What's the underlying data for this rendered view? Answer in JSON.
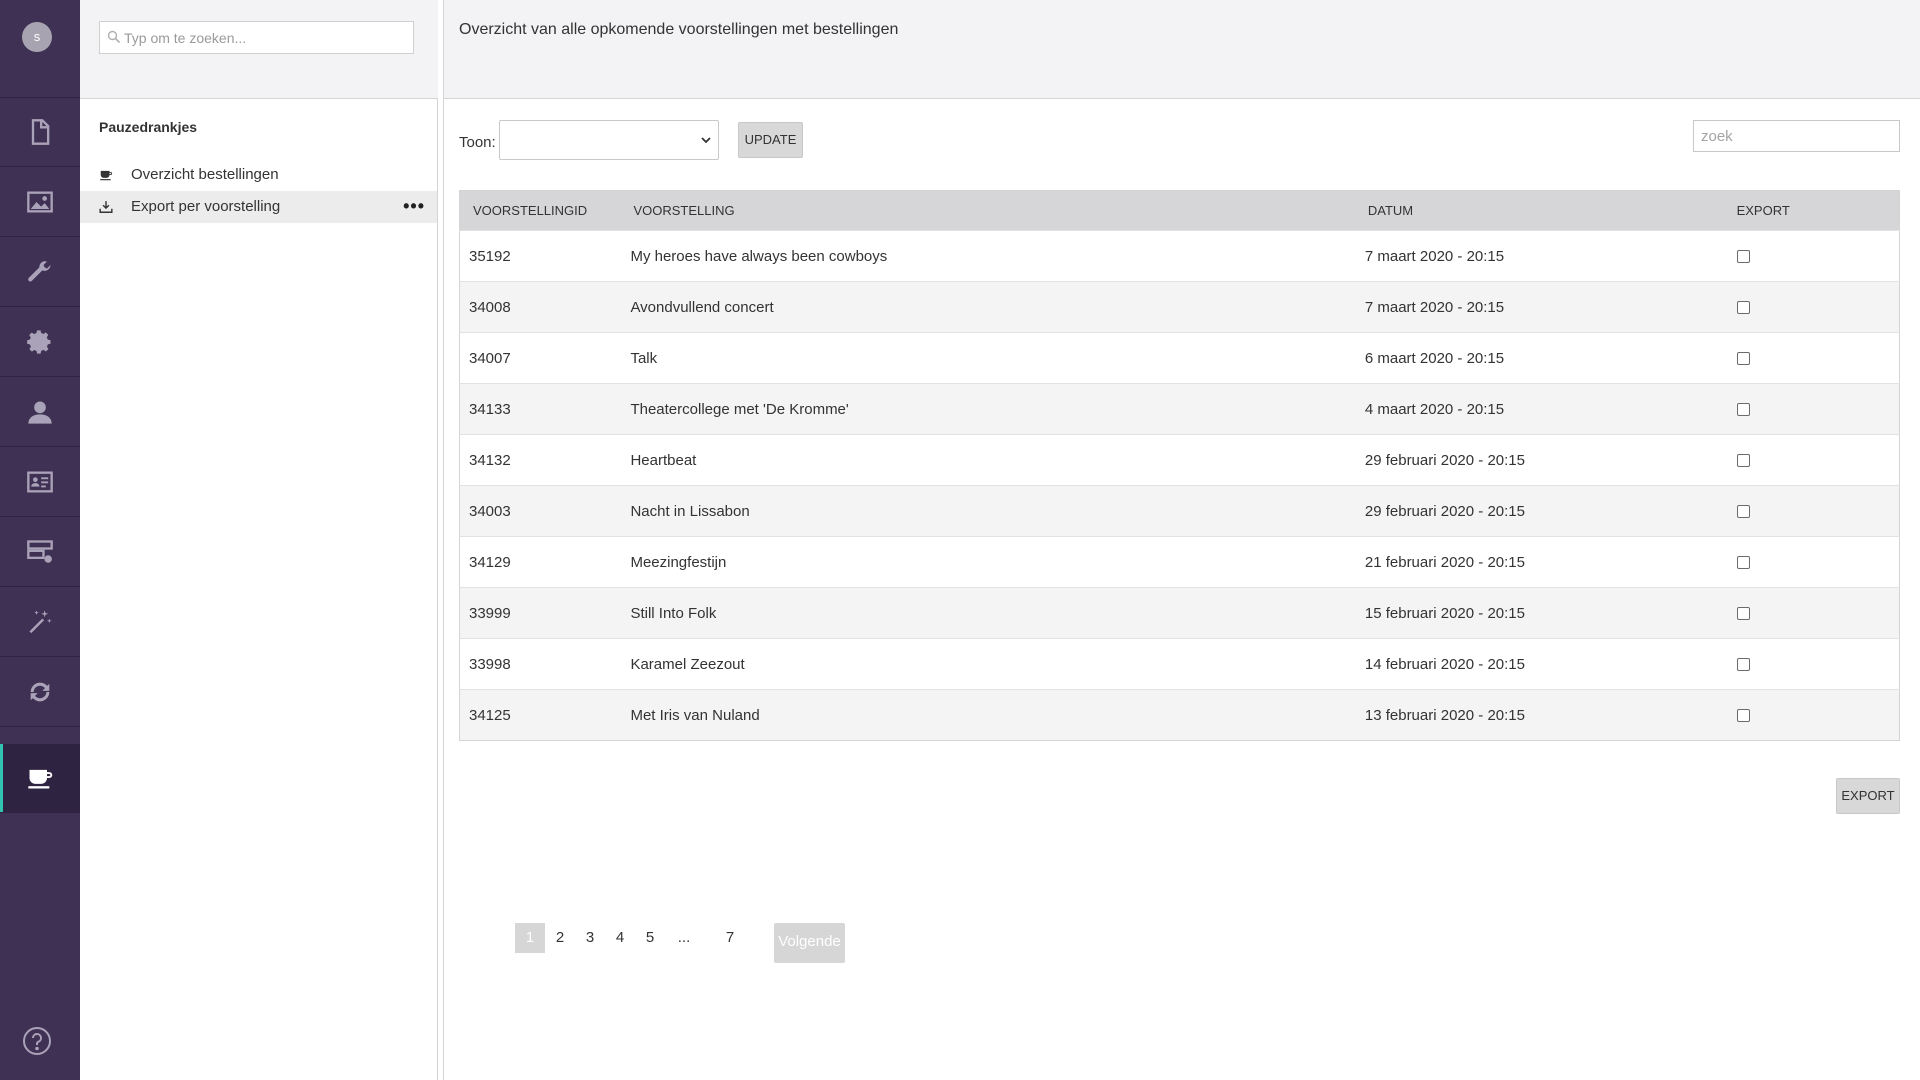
{
  "rail": {
    "avatar_letter": "s",
    "items": [
      {
        "icon": "document-icon"
      },
      {
        "icon": "image-icon"
      },
      {
        "icon": "wrench-icon"
      },
      {
        "icon": "gear-icon"
      },
      {
        "icon": "user-icon"
      },
      {
        "icon": "id-card-icon"
      },
      {
        "icon": "server-settings-icon"
      },
      {
        "icon": "magic-wand-icon"
      },
      {
        "icon": "sync-icon"
      },
      {
        "icon": "coffee-cup-icon",
        "active": true
      }
    ],
    "help_icon": "help-icon",
    "accent_color": "#33c3b0",
    "background_color": "#3e3153"
  },
  "tree": {
    "search_placeholder": "Typ om te zoeken...",
    "section_title": "Pauzedrankjes",
    "items": [
      {
        "label": "Overzicht bestellingen",
        "icon": "coffee-cup-icon"
      },
      {
        "label": "Export per voorstelling",
        "icon": "download-icon",
        "selected": true,
        "more": "•••"
      }
    ]
  },
  "main": {
    "title": "Overzicht van alle opkomende voorstellingen met bestellingen",
    "toon_label": "Toon:",
    "toon_value": "",
    "update_label": "UPDATE",
    "search_placeholder": "zoek",
    "export_label": "EXPORT",
    "table": {
      "headers": [
        "VOORSTELLINGID",
        "VOORSTELLING",
        "DATUM",
        "EXPORT"
      ],
      "rows": [
        {
          "id": "35192",
          "name": "My heroes have always been cowboys",
          "date": "7 maart 2020 - 20:15",
          "export": false
        },
        {
          "id": "34008",
          "name": "Avondvullend concert",
          "date": "7 maart 2020 - 20:15",
          "export": false
        },
        {
          "id": "34007",
          "name": "Talk",
          "date": "6 maart 2020 - 20:15",
          "export": false
        },
        {
          "id": "34133",
          "name": "Theatercollege met 'De Kromme'",
          "date": "4 maart 2020 - 20:15",
          "export": false
        },
        {
          "id": "34132",
          "name": "Heartbeat",
          "date": "29 februari 2020 - 20:15",
          "export": false
        },
        {
          "id": "34003",
          "name": "Nacht in Lissabon",
          "date": "29 februari 2020 - 20:15",
          "export": false
        },
        {
          "id": "34129",
          "name": "Meezingfestijn",
          "date": "21 februari 2020 - 20:15",
          "export": false
        },
        {
          "id": "33999",
          "name": "Still Into Folk",
          "date": "15 februari 2020 - 20:15",
          "export": false
        },
        {
          "id": "33998",
          "name": "Karamel Zeezout",
          "date": "14 februari 2020 - 20:15",
          "export": false
        },
        {
          "id": "34125",
          "name": "Met Iris van Nuland",
          "date": "13 februari 2020 - 20:15",
          "export": false
        }
      ]
    },
    "pagination": {
      "pages": [
        "1",
        "2",
        "3",
        "4",
        "5",
        "...",
        "7"
      ],
      "current": "1",
      "next_label": "Volgende"
    }
  }
}
